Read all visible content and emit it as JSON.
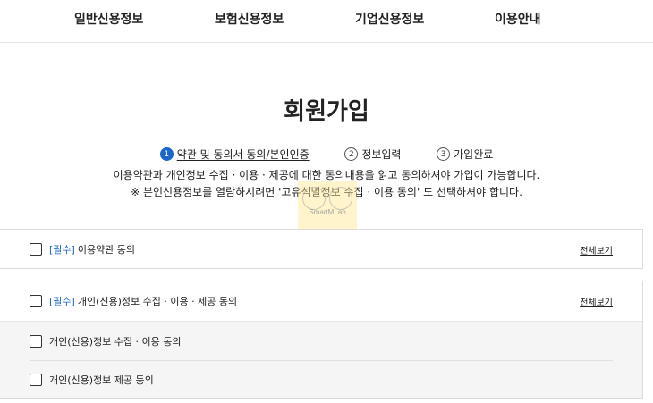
{
  "nav": {
    "items": [
      "일반신용정보",
      "보험신용정보",
      "기업신용정보",
      "이용안내"
    ]
  },
  "page": {
    "title": "회원가입"
  },
  "steps": [
    {
      "num": "1",
      "label": "약관 및 동의서 동의/본인인증",
      "active": true
    },
    {
      "num": "2",
      "label": "정보입력",
      "active": false
    },
    {
      "num": "3",
      "label": "가입완료",
      "active": false
    }
  ],
  "step_separator": "—",
  "notice": {
    "line1": "이용약관과 개인정보 수집 · 이용 · 제공에 대한 동의내용을 읽고 동의하셔야 가입이 가능합니다.",
    "line2": "※ 본인신용정보를 열람하시려면 '고유식별정보 수집 · 이용 동의' 도 선택하셔야 합니다."
  },
  "watermark": {
    "text": "SmartMLab"
  },
  "agreements": {
    "terms": {
      "required_tag": "[필수]",
      "label": "이용약관 동의",
      "view_all": "전체보기"
    },
    "personal_info": {
      "required_tag": "[필수]",
      "label": "개인(신용)정보 수집 · 이용 · 제공 동의",
      "view_all": "전체보기",
      "sub_items": [
        {
          "label": "개인(신용)정보 수집 · 이용 동의"
        },
        {
          "label": "개인(신용)정보 제공 동의"
        }
      ]
    }
  },
  "colors": {
    "accent": "#1b66c9",
    "sub_background": "#f5f5f5"
  }
}
